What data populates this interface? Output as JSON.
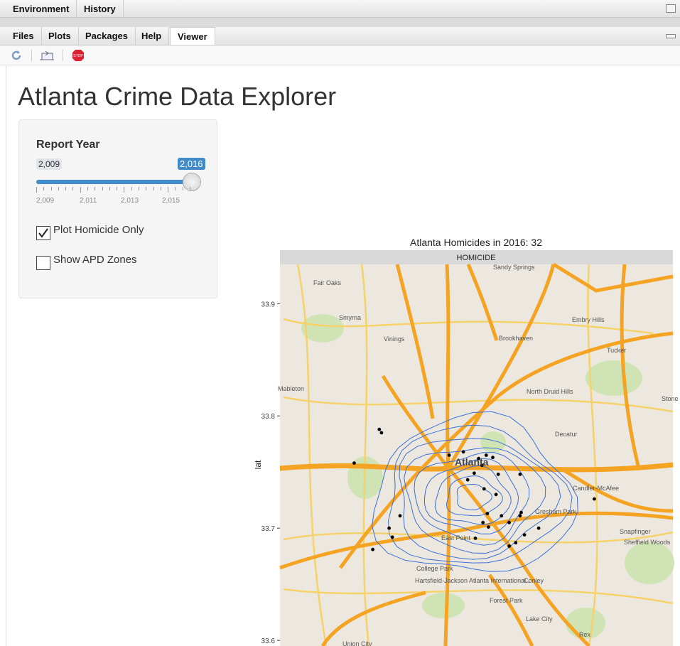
{
  "top_tabs": [
    {
      "label": "Environment"
    },
    {
      "label": "History"
    }
  ],
  "viewer_tabs": [
    {
      "label": "Files"
    },
    {
      "label": "Plots"
    },
    {
      "label": "Packages"
    },
    {
      "label": "Help"
    },
    {
      "label": "Viewer",
      "active": true
    }
  ],
  "toolbar": {
    "icons": [
      "refresh-icon",
      "open-in-browser-icon",
      "stop-icon"
    ]
  },
  "app": {
    "title": "Atlanta Crime Data Explorer",
    "slider": {
      "label": "Report Year",
      "min": 2009,
      "max": 2016,
      "min_label": "2,009",
      "max_label": "2,016",
      "value": 2016,
      "tick_labels": [
        "2,009",
        "2,011",
        "2,013",
        "2,015"
      ]
    },
    "checkboxes": [
      {
        "label": "Plot Homicide Only",
        "checked": true
      },
      {
        "label": "Show APD Zones",
        "checked": false
      }
    ]
  },
  "chart_data": {
    "type": "scatter",
    "title": "Atlanta Homicides in 2016: 32",
    "facet_label": "HOMICIDE",
    "ylabel": "lat",
    "xlabel": "",
    "yticks": [
      33.9,
      33.8,
      33.7,
      33.6
    ],
    "ylim": [
      33.595,
      33.935
    ],
    "xlim": [
      -84.57,
      -84.21
    ],
    "point_color": "#000000",
    "contour_color": "#3b6fd6",
    "background": "map",
    "map_places": [
      "Sandy Springs",
      "Fair Oaks",
      "Smyrna",
      "Vinings",
      "Brookhaven",
      "Embry Hills",
      "Tucker",
      "Mableton",
      "North Druid Hills",
      "Decatur",
      "Atlanta",
      "Candler-McAfee",
      "Gresham Park",
      "East Point",
      "College Park",
      "Hartsfield-Jackson Atlanta International...",
      "Conley",
      "Forest Park",
      "Lake City",
      "Snapfinger",
      "Sheffield Woods",
      "Rex",
      "Union City",
      "Stone Mountain"
    ],
    "x": [
      -84.479,
      -84.477,
      -84.502,
      -84.402,
      -84.415,
      -84.388,
      -84.381,
      -84.375,
      -84.385,
      -84.392,
      -84.37,
      -84.398,
      -84.383,
      -84.372,
      -84.35,
      -84.367,
      -84.384,
      -84.379,
      -84.36,
      -84.349,
      -84.35,
      -84.346,
      -84.333,
      -84.282,
      -84.47,
      -84.46,
      -84.467,
      -84.391,
      -84.38,
      -84.36,
      -84.354,
      -84.485
    ],
    "y": [
      33.788,
      33.785,
      33.758,
      33.768,
      33.765,
      33.762,
      33.765,
      33.763,
      33.756,
      33.749,
      33.748,
      33.743,
      33.735,
      33.73,
      33.748,
      33.711,
      33.705,
      33.701,
      33.705,
      33.714,
      33.711,
      33.694,
      33.7,
      33.726,
      33.7,
      33.711,
      33.692,
      33.691,
      33.713,
      33.684,
      33.687,
      33.681
    ]
  }
}
